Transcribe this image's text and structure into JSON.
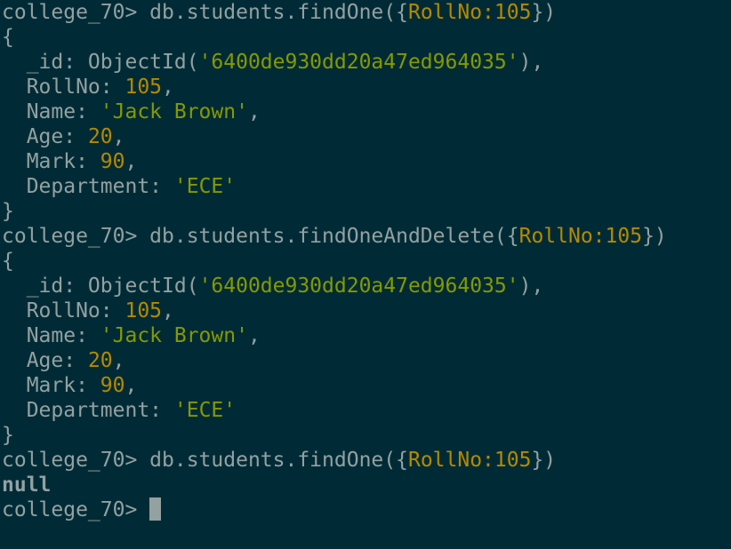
{
  "prompt": "college_70> ",
  "colors": {
    "background": "#002b36",
    "text": "#93a1a1",
    "number": "#b58900",
    "string": "#859900"
  },
  "lines": [
    {
      "kind": "cmd",
      "segments": [
        {
          "t": "college_70> db.students.findOne({",
          "c": "plain"
        },
        {
          "t": "RollNo:105",
          "c": "num"
        },
        {
          "t": "})",
          "c": "plain"
        }
      ]
    },
    {
      "kind": "out",
      "segments": [
        {
          "t": "{",
          "c": "plain"
        }
      ]
    },
    {
      "kind": "out",
      "segments": [
        {
          "t": "  _id: ObjectId(",
          "c": "plain"
        },
        {
          "t": "'6400de930dd20a47ed964035'",
          "c": "str"
        },
        {
          "t": "),",
          "c": "plain"
        }
      ]
    },
    {
      "kind": "out",
      "segments": [
        {
          "t": "  RollNo: ",
          "c": "plain"
        },
        {
          "t": "105",
          "c": "num"
        },
        {
          "t": ",",
          "c": "plain"
        }
      ]
    },
    {
      "kind": "out",
      "segments": [
        {
          "t": "  Name: ",
          "c": "plain"
        },
        {
          "t": "'Jack Brown'",
          "c": "str"
        },
        {
          "t": ",",
          "c": "plain"
        }
      ]
    },
    {
      "kind": "out",
      "segments": [
        {
          "t": "  Age: ",
          "c": "plain"
        },
        {
          "t": "20",
          "c": "num"
        },
        {
          "t": ",",
          "c": "plain"
        }
      ]
    },
    {
      "kind": "out",
      "segments": [
        {
          "t": "  Mark: ",
          "c": "plain"
        },
        {
          "t": "90",
          "c": "num"
        },
        {
          "t": ",",
          "c": "plain"
        }
      ]
    },
    {
      "kind": "out",
      "segments": [
        {
          "t": "  Department: ",
          "c": "plain"
        },
        {
          "t": "'ECE'",
          "c": "str"
        }
      ]
    },
    {
      "kind": "out",
      "segments": [
        {
          "t": "}",
          "c": "plain"
        }
      ]
    },
    {
      "kind": "cmd",
      "segments": [
        {
          "t": "college_70> db.students.findOneAndDelete({",
          "c": "plain"
        },
        {
          "t": "RollNo:105",
          "c": "num"
        },
        {
          "t": "})",
          "c": "plain"
        }
      ]
    },
    {
      "kind": "out",
      "segments": [
        {
          "t": "{",
          "c": "plain"
        }
      ]
    },
    {
      "kind": "out",
      "segments": [
        {
          "t": "  _id: ObjectId(",
          "c": "plain"
        },
        {
          "t": "'6400de930dd20a47ed964035'",
          "c": "str"
        },
        {
          "t": "),",
          "c": "plain"
        }
      ]
    },
    {
      "kind": "out",
      "segments": [
        {
          "t": "  RollNo: ",
          "c": "plain"
        },
        {
          "t": "105",
          "c": "num"
        },
        {
          "t": ",",
          "c": "plain"
        }
      ]
    },
    {
      "kind": "out",
      "segments": [
        {
          "t": "  Name: ",
          "c": "plain"
        },
        {
          "t": "'Jack Brown'",
          "c": "str"
        },
        {
          "t": ",",
          "c": "plain"
        }
      ]
    },
    {
      "kind": "out",
      "segments": [
        {
          "t": "  Age: ",
          "c": "plain"
        },
        {
          "t": "20",
          "c": "num"
        },
        {
          "t": ",",
          "c": "plain"
        }
      ]
    },
    {
      "kind": "out",
      "segments": [
        {
          "t": "  Mark: ",
          "c": "plain"
        },
        {
          "t": "90",
          "c": "num"
        },
        {
          "t": ",",
          "c": "plain"
        }
      ]
    },
    {
      "kind": "out",
      "segments": [
        {
          "t": "  Department: ",
          "c": "plain"
        },
        {
          "t": "'ECE'",
          "c": "str"
        }
      ]
    },
    {
      "kind": "out",
      "segments": [
        {
          "t": "}",
          "c": "plain"
        }
      ]
    },
    {
      "kind": "cmd",
      "segments": [
        {
          "t": "college_70> db.students.findOne({",
          "c": "plain"
        },
        {
          "t": "RollNo:105",
          "c": "num"
        },
        {
          "t": "})",
          "c": "plain"
        }
      ]
    },
    {
      "kind": "out",
      "segments": [
        {
          "t": "null",
          "c": "bold"
        }
      ]
    }
  ]
}
